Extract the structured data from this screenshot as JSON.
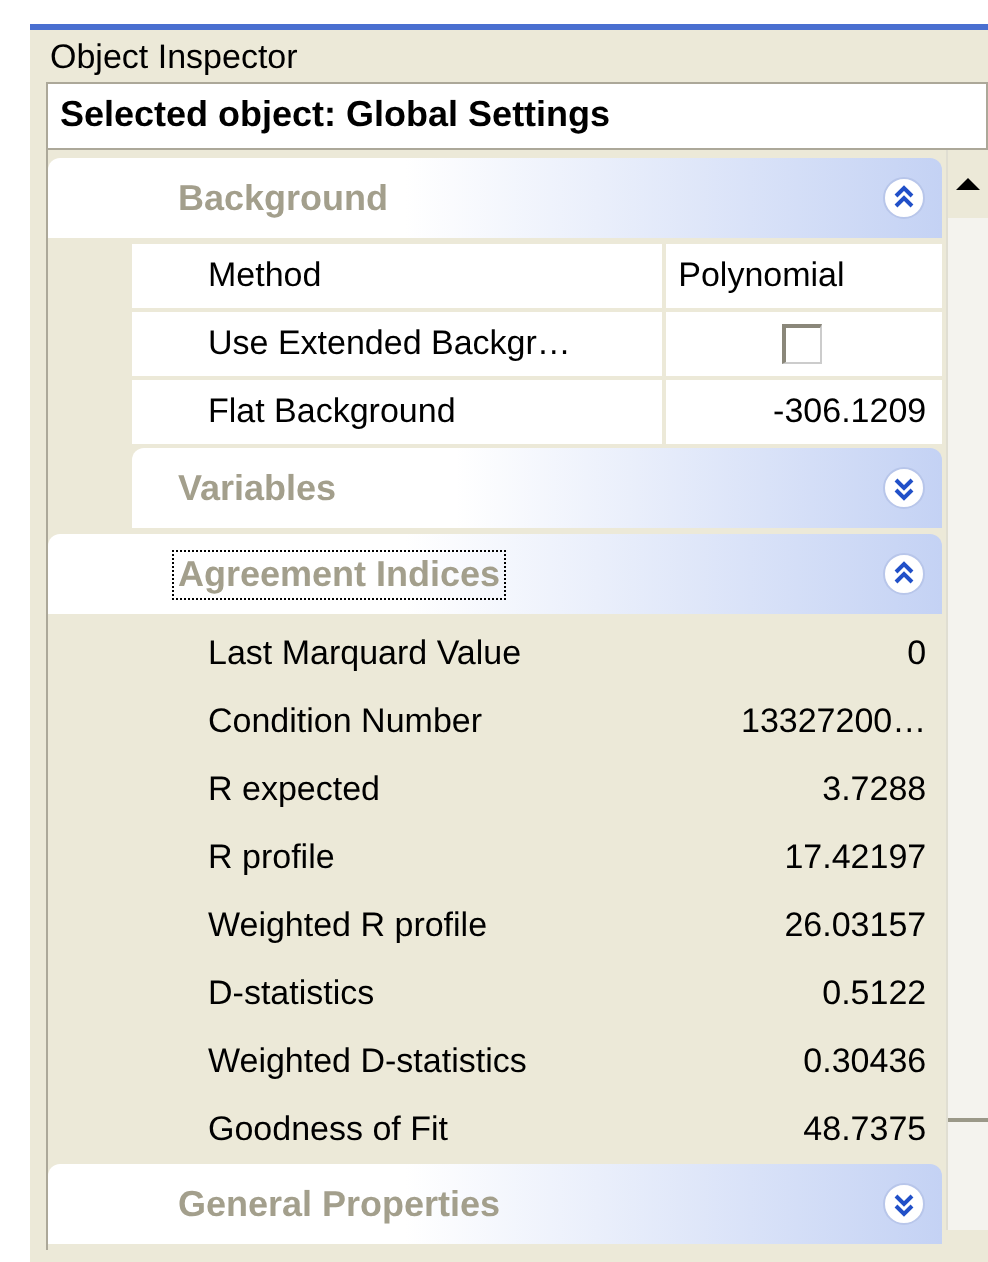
{
  "window": {
    "title": "Object Inspector"
  },
  "selected_object": "Selected object: Global Settings",
  "groups": [
    {
      "title": "Background",
      "expanded": true,
      "focused": false,
      "kind": "grid",
      "rows": [
        {
          "label": "Method",
          "kind": "text",
          "value": "Polynomial"
        },
        {
          "label": "Use Extended Backgr…",
          "kind": "checkbox",
          "checked": false
        },
        {
          "label": "Flat Background",
          "kind": "number",
          "value": "-306.1209"
        }
      ]
    },
    {
      "title": "Variables",
      "expanded": false,
      "focused": false,
      "kind": "grid"
    },
    {
      "title": "Agreement Indices",
      "expanded": true,
      "focused": true,
      "kind": "readonly",
      "rows": [
        {
          "label": "Last Marquard Value",
          "kind": "number",
          "value": "0"
        },
        {
          "label": "Condition Number",
          "kind": "number",
          "value": "13327200…"
        },
        {
          "label": "R expected",
          "kind": "number",
          "value": "3.7288"
        },
        {
          "label": "R profile",
          "kind": "number",
          "value": "17.42197"
        },
        {
          "label": "Weighted R profile",
          "kind": "number",
          "value": "26.03157"
        },
        {
          "label": "D-statistics",
          "kind": "number",
          "value": "0.5122"
        },
        {
          "label": "Weighted D-statistics",
          "kind": "number",
          "value": "0.30436"
        },
        {
          "label": "Goodness of Fit",
          "kind": "number",
          "value": "48.7375"
        }
      ]
    },
    {
      "title": "General Properties",
      "expanded": false,
      "focused": false,
      "kind": "grid"
    }
  ]
}
